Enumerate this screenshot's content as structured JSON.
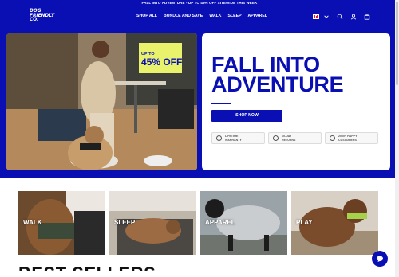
{
  "announcement": "FALL INTO ADVENTURE - UP TO 45% OFF SITEWIDE THIS WEEK",
  "brand": {
    "logo_lines": [
      "DOG",
      "FRIENDLY",
      "CO."
    ]
  },
  "nav": {
    "items": [
      "SHOP ALL",
      "BUNDLE AND SAVE",
      "WALK",
      "SLEEP",
      "APPAREL"
    ]
  },
  "header_icons": {
    "country": "canada-flag-icon",
    "icons": [
      "chevron-down-icon",
      "search-icon",
      "account-icon",
      "cart-icon"
    ]
  },
  "hero": {
    "badge_small": "UP TO",
    "badge_big": "45% OFF",
    "title_line1": "FALL INTO",
    "title_line2": "ADVENTURE",
    "cta": "SHOP NOW",
    "perks": [
      {
        "icon": "shield-icon",
        "text": "LIFETIME\nWARRANTY"
      },
      {
        "icon": "return-icon",
        "text": "60-DAY\nRETURNS"
      },
      {
        "icon": "smile-icon",
        "text": "2000+ HAPPY\nCUSTOMERS"
      }
    ]
  },
  "categories": [
    "WALK",
    "SLEEP",
    "APPAREL",
    "PLAY"
  ],
  "section_title": "BEST SELLERS",
  "colors": {
    "brand_blue": "#0a0fb4",
    "badge_yellow": "#e8f26a",
    "white": "#ffffff"
  }
}
